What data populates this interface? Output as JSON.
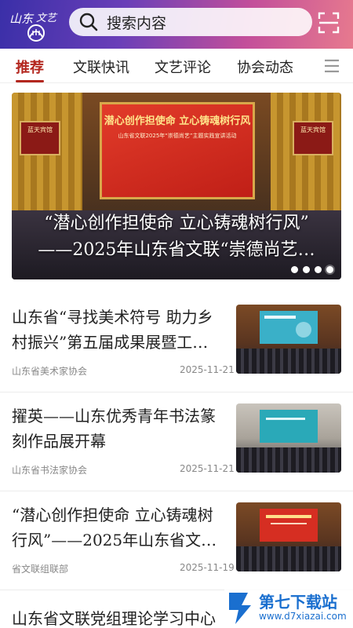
{
  "header": {
    "logo_text": "山东文艺",
    "search_placeholder": "搜索内容",
    "brand_color": "#b3261e"
  },
  "tabs": [
    {
      "label": "推荐",
      "active": true
    },
    {
      "label": "文联快讯",
      "active": false
    },
    {
      "label": "文艺评论",
      "active": false
    },
    {
      "label": "协会动态",
      "active": false
    }
  ],
  "banner": {
    "screen_line1": "潜心创作担使命 立心铸魂树行风",
    "screen_line2": "山东省文联2025年“崇德尚艺”主题实践宣讲活动",
    "sign_left": "蓝天宾馆",
    "sign_right": "蓝天宾馆",
    "title_line1": "“潜心创作担使命 立心铸魂树行风”",
    "title_line2": "——2025年山东省文联“崇德尚艺…",
    "dots_total": 4,
    "dots_active_index": 3
  },
  "news": [
    {
      "title": "山东省“寻找美术符号 助力乡村振兴”第五届成果展暨工…",
      "source": "山东省美术家协会",
      "date": "2025-11-21"
    },
    {
      "title": "擢英——山东优秀青年书法篆刻作品展开幕",
      "source": "山东省书法家协会",
      "date": "2025-11-21"
    },
    {
      "title": "“潜心创作担使命 立心铸魂树行风”——2025年山东省文…",
      "source": "省文联组联部",
      "date": "2025-11-19"
    }
  ],
  "last_title": "山东省文联党组理论学习中心",
  "watermark": {
    "text": "第七下载站",
    "sub": "www.d7xiazai.com"
  }
}
